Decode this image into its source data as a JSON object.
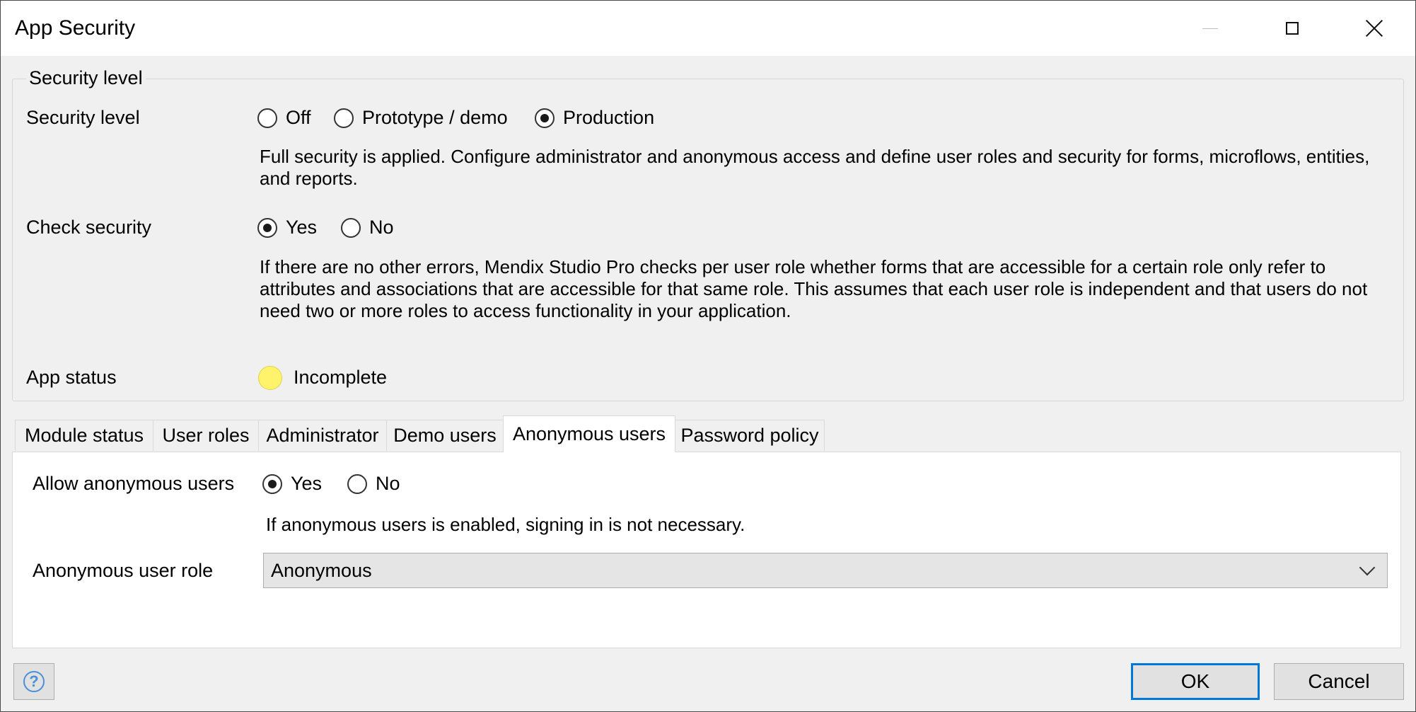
{
  "window": {
    "title": "App Security",
    "controls": {
      "minimize": "minimize-icon",
      "maximize": "maximize-icon",
      "close": "close-icon"
    }
  },
  "security_group": {
    "legend": "Security level",
    "security_level": {
      "label": "Security level",
      "options": [
        "Off",
        "Prototype / demo",
        "Production"
      ],
      "selected": "Production",
      "description": "Full security is applied. Configure administrator and anonymous access and define user roles and security for forms, microflows, entities, and reports."
    },
    "check_security": {
      "label": "Check security",
      "options": [
        "Yes",
        "No"
      ],
      "selected": "Yes",
      "description": "If there are no other errors, Mendix Studio Pro checks per user role whether forms that are accessible for a certain role only refer to attributes and associations that are accessible for that same role. This assumes that each user role is independent and that users do not need two or more roles to access functionality in your application."
    },
    "app_status": {
      "label": "App status",
      "value": "Incomplete",
      "color": "#fff36b"
    }
  },
  "tabs": {
    "items": [
      "Module status",
      "User roles",
      "Administrator",
      "Demo users",
      "Anonymous users",
      "Password policy"
    ],
    "active": "Anonymous users"
  },
  "anonymous_panel": {
    "allow_label": "Allow anonymous users",
    "allow_options": [
      "Yes",
      "No"
    ],
    "allow_selected": "Yes",
    "allow_hint": "If anonymous users is enabled, signing in is not necessary.",
    "role_label": "Anonymous user role",
    "role_value": "Anonymous"
  },
  "footer": {
    "help_icon": "help-icon",
    "ok_label": "OK",
    "cancel_label": "Cancel",
    "accent_color": "#0078d7"
  }
}
